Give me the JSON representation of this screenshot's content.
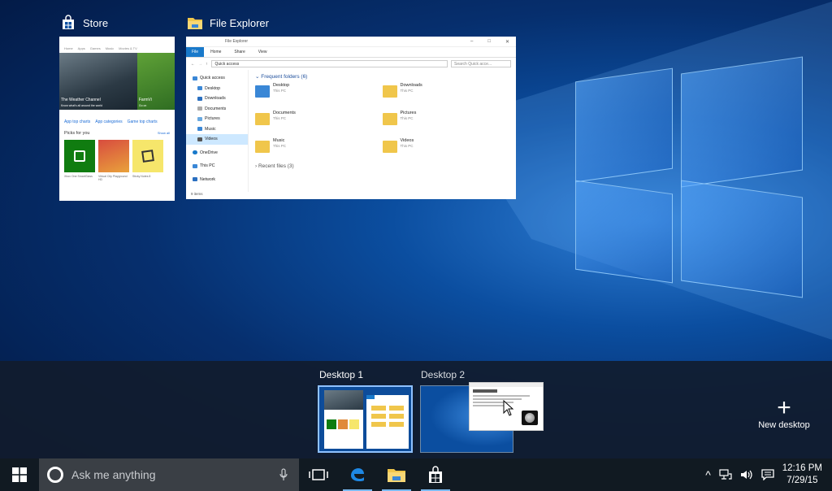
{
  "windows": [
    {
      "title": "Store"
    },
    {
      "title": "File Explorer"
    }
  ],
  "store": {
    "nav": [
      "Home",
      "Apps",
      "Games",
      "Music",
      "Movies & TV"
    ],
    "hero_left": "The Weather Channel",
    "hero_left_sub": "Know what's all around the world",
    "hero_right": "FarmVi",
    "hero_right_sub": "Go on",
    "links": [
      "App top charts",
      "App categories",
      "Game top charts"
    ],
    "picks_title": "Picks for you",
    "show_all": "Show all",
    "apps": [
      "Xbox One SmartGlass",
      "Virtual City Playground HD",
      "Sticky Notes 8"
    ]
  },
  "explorer": {
    "title_bar": "File Explorer",
    "ribbon_tabs": [
      "File",
      "Home",
      "Share",
      "View"
    ],
    "address": "Quick access",
    "search_placeholder": "Search Quick acce...",
    "nav_items": [
      "Quick access",
      "Desktop",
      "Downloads",
      "Documents",
      "Pictures",
      "Music",
      "Videos",
      "OneDrive",
      "This PC",
      "Network"
    ],
    "frequent_header": "Frequent folders (6)",
    "folders": [
      {
        "name": "Desktop",
        "location": "This PC"
      },
      {
        "name": "Downloads",
        "location": "This PC"
      },
      {
        "name": "Documents",
        "location": "This PC"
      },
      {
        "name": "Pictures",
        "location": "This PC"
      },
      {
        "name": "Music",
        "location": "This PC"
      },
      {
        "name": "Videos",
        "location": "This PC"
      }
    ],
    "recent_header": "Recent files (3)",
    "status": "9 items"
  },
  "desktops": [
    {
      "label": "Desktop 1",
      "active": true
    },
    {
      "label": "Desktop 2",
      "active": false
    }
  ],
  "new_desktop_label": "New desktop",
  "taskbar": {
    "search_placeholder": "Ask me anything",
    "time": "12:16 PM",
    "date": "7/29/15"
  },
  "colors": {
    "accent": "#1979ca",
    "taskbar": "#111a22",
    "active_desktop_border": "#8fc1ff"
  }
}
